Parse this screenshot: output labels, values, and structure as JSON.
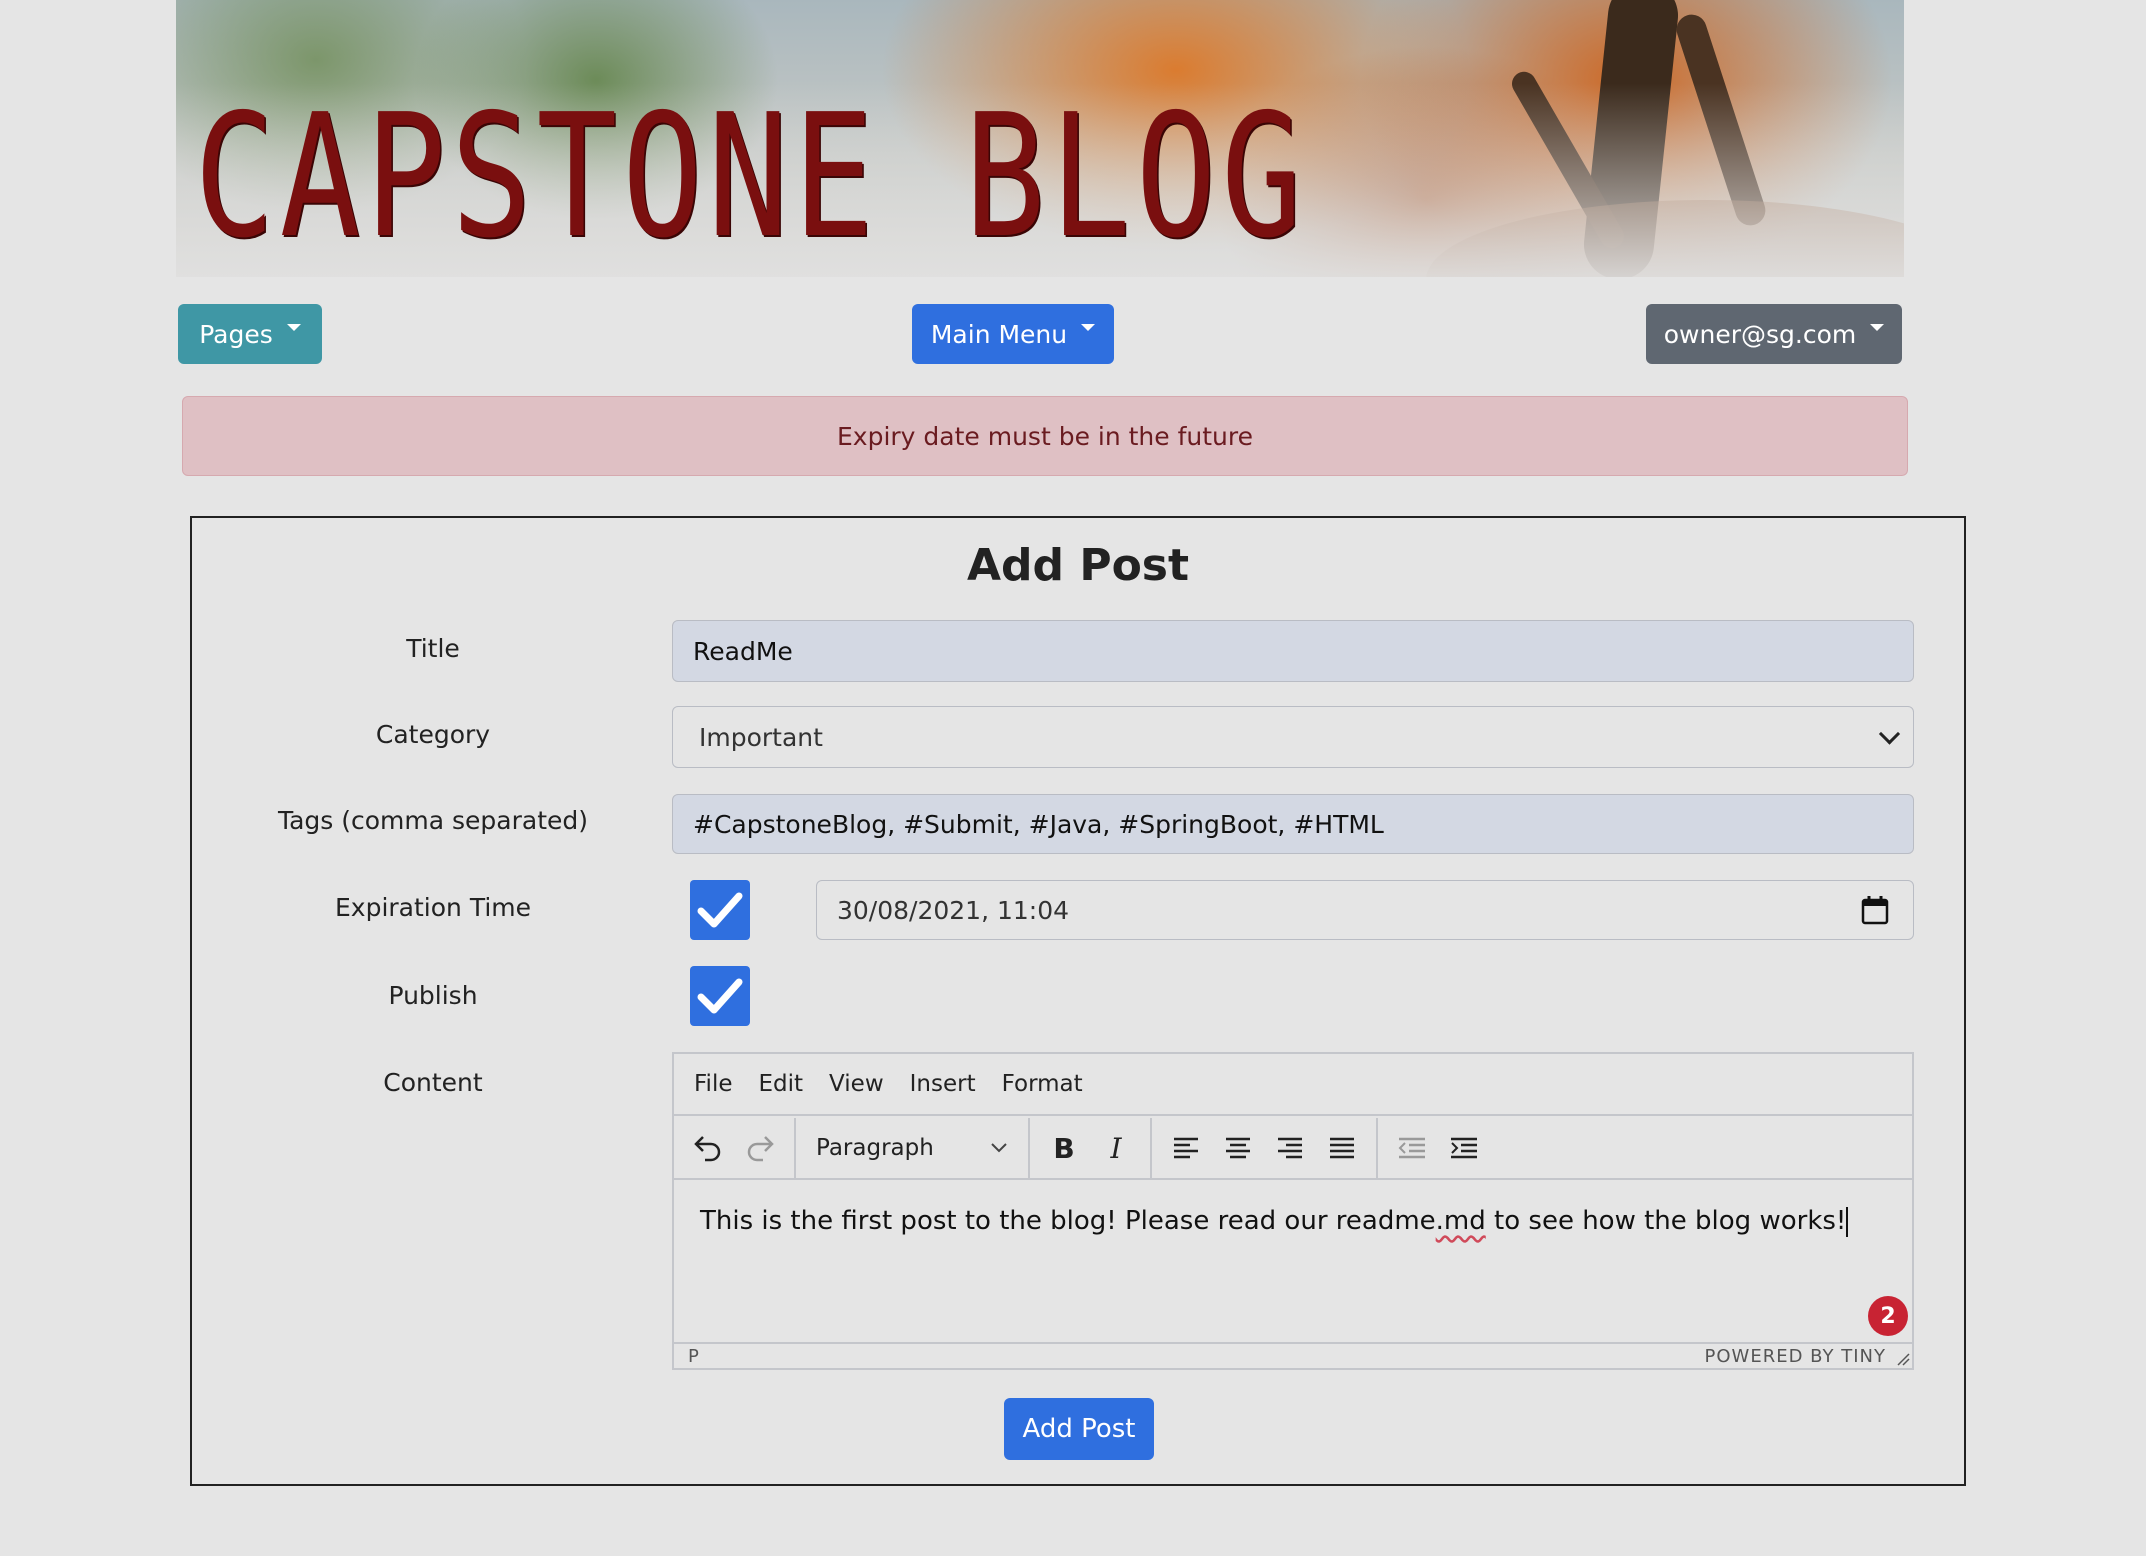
{
  "banner": {
    "title": "CAPSTONE BLOG"
  },
  "nav": {
    "pages_label": "Pages",
    "main_menu_label": "Main Menu",
    "user_label": "owner@sg.com"
  },
  "alert": {
    "message": "Expiry date must be in the future"
  },
  "form": {
    "heading": "Add Post",
    "title": {
      "label": "Title",
      "value": "ReadMe"
    },
    "category": {
      "label": "Category",
      "value": "Important"
    },
    "tags": {
      "label": "Tags (comma separated)",
      "value": "#CapstoneBlog, #Submit, #Java, #SpringBoot, #HTML"
    },
    "expiration": {
      "label": "Expiration Time",
      "checked": true,
      "value": "30/08/2021, 11:04"
    },
    "publish": {
      "label": "Publish",
      "checked": true
    },
    "content": {
      "label": "Content"
    },
    "submit_label": "Add Post"
  },
  "editor": {
    "menu": [
      "File",
      "Edit",
      "View",
      "Insert",
      "Format"
    ],
    "block_format": "Paragraph",
    "body_text_before": "This is the first post to the blog! Please read our readme",
    "body_text_spell": ".md",
    "body_text_after": " to see how the blog works!",
    "notification_count": "2",
    "status_path": "P",
    "powered_by": "POWERED BY TINY"
  },
  "colors": {
    "primary": "#2f6fdf",
    "info": "#3f97a5",
    "secondary": "#5f6771",
    "danger_bg": "#dfc0c4",
    "danger_text": "#6a1b20"
  }
}
